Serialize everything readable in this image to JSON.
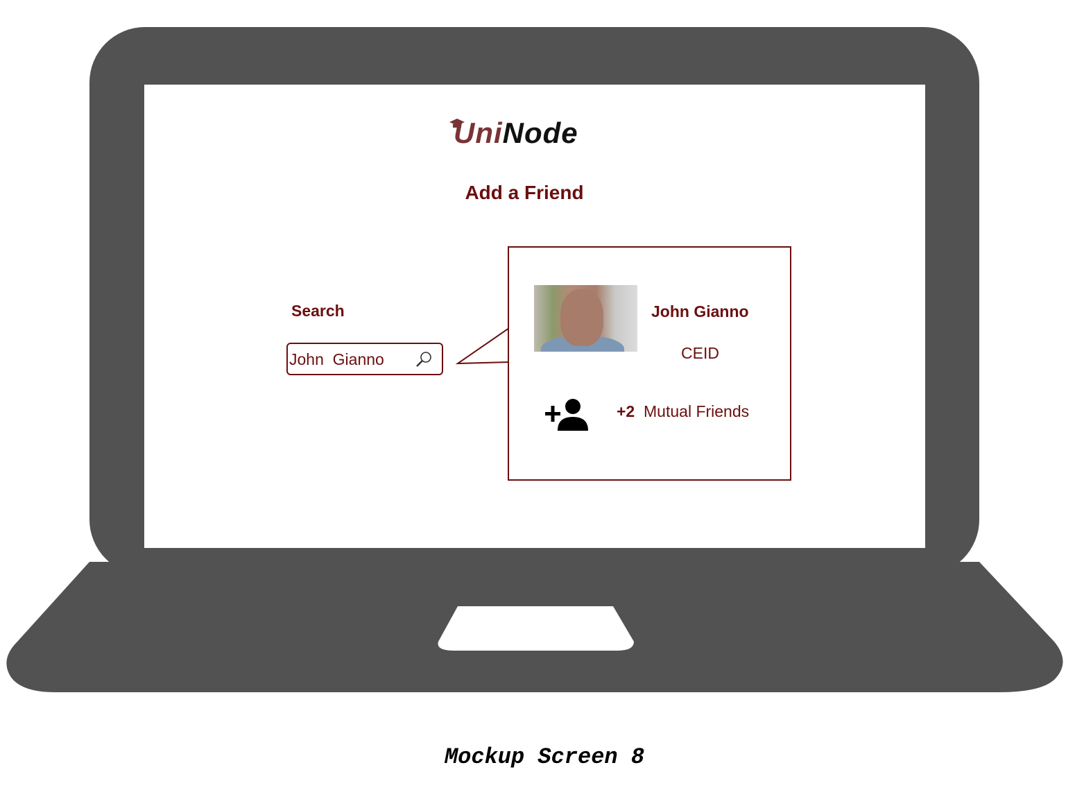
{
  "app": {
    "logo_uni": "Uni",
    "logo_node": "Node",
    "page_title": "Add a Friend"
  },
  "search": {
    "label": "Search",
    "value": "John  Gianno"
  },
  "result": {
    "name": "John Gianno",
    "department": "CEID",
    "mutual_count": "+2",
    "mutual_label": "Mutual Friends"
  },
  "caption": "Mockup Screen 8",
  "colors": {
    "accent": "#6b0f0f",
    "laptop": "#525252"
  }
}
